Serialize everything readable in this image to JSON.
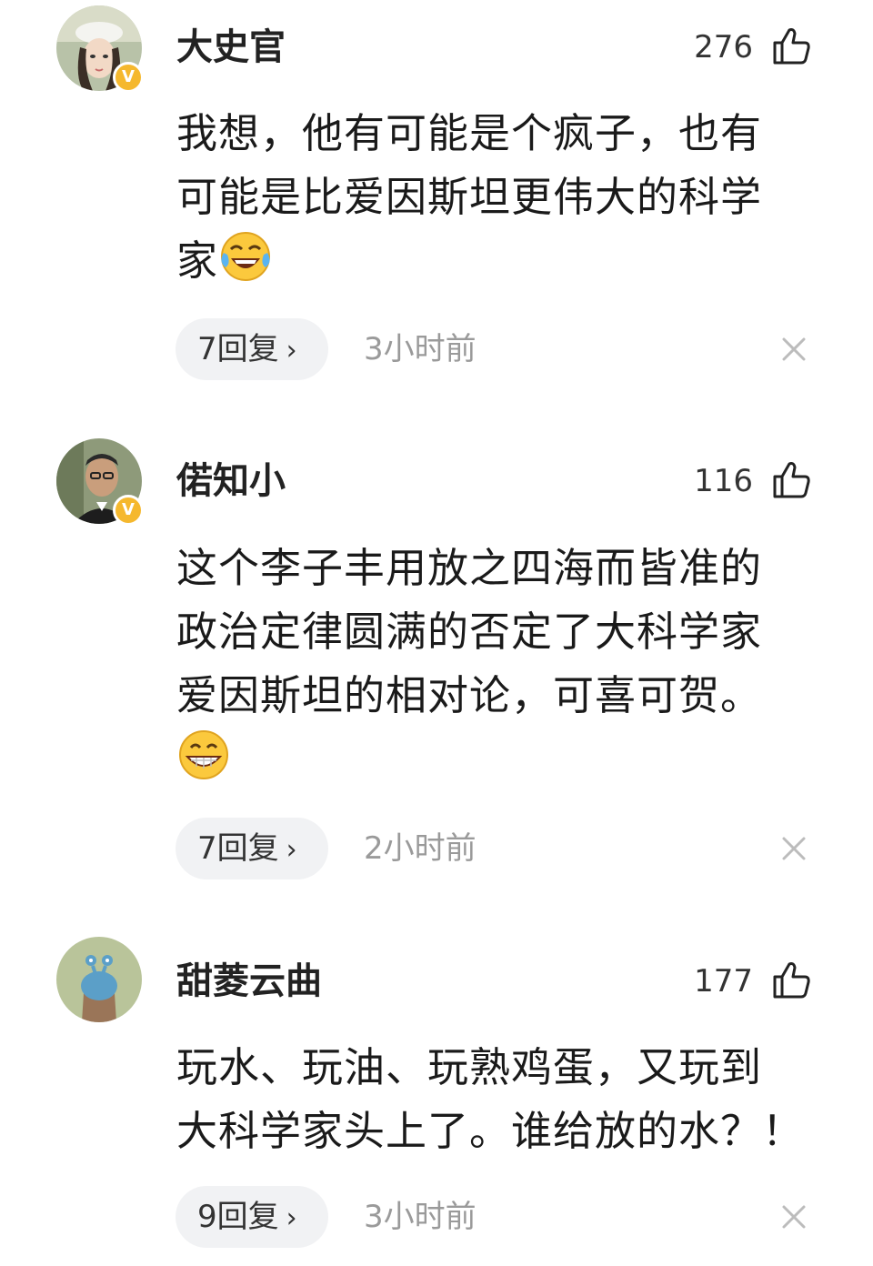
{
  "comments": [
    {
      "username": "大史官",
      "likes": "276",
      "text_lines": [
        "我想，他有可能是个疯子，也有",
        "可能是比爱因斯坦更伟大的科学",
        "家"
      ],
      "emoji": "laughing-tears-emoji",
      "verified_badge": "V",
      "replies_label": "7回复",
      "time": "3小时前"
    },
    {
      "username": "偌知小",
      "likes": "116",
      "text_lines": [
        "这个李子丰用放之四海而皆准的",
        "政治定律圆满的否定了大科学家",
        "爱因斯坦的相对论，可喜可贺。"
      ],
      "emoji": "grinning-emoji",
      "verified_badge": "V",
      "replies_label": "7回复",
      "time": "2小时前"
    },
    {
      "username": "甜菱云曲",
      "likes": "177",
      "text_lines": [
        "玩水、玩油、玩熟鸡蛋，又玩到",
        "大科学家头上了。谁给放的水？！"
      ],
      "replies_label": "9回复",
      "time": "3小时前"
    }
  ],
  "icons": {
    "like": "thumbs-up-icon",
    "chevron": "chevron-right-icon",
    "close": "close-icon"
  },
  "colors": {
    "badge": "#f5b82e",
    "pill_bg": "#f1f2f4",
    "time": "#9a9a9a"
  }
}
